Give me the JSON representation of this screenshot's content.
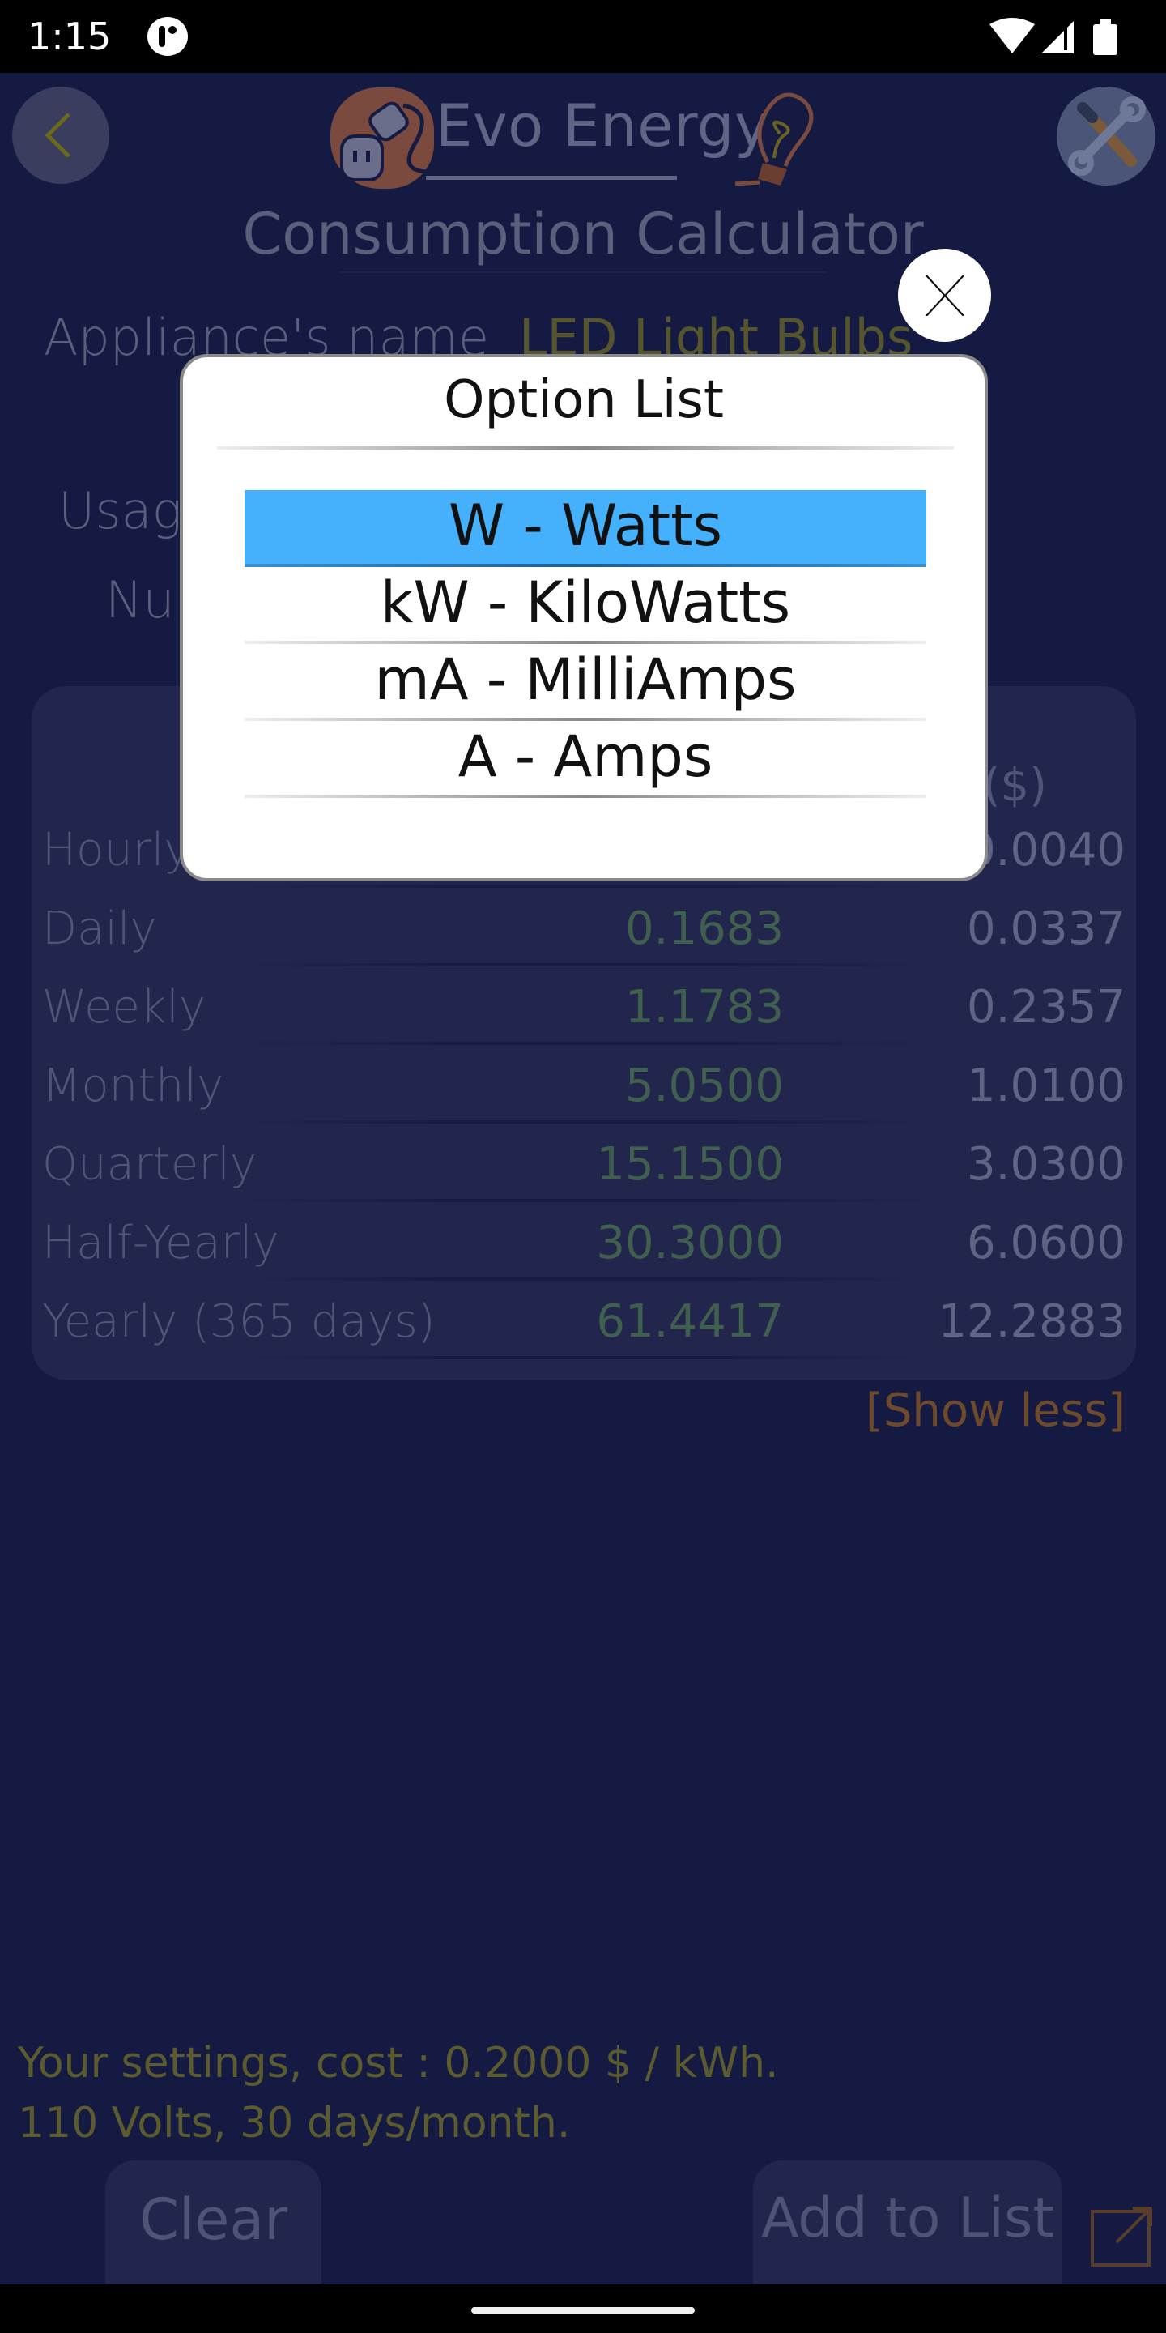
{
  "status_bar": {
    "time": "1:15",
    "icons": [
      "notification-app-icon",
      "wifi-icon",
      "signal-icon",
      "battery-icon"
    ]
  },
  "header": {
    "back_icon": "chevron-left-icon",
    "logo_text": "Evo Energy",
    "settings_icon": "tools-icon"
  },
  "page": {
    "title": "Consumption Calculator",
    "appliance_label": "Appliance's name",
    "appliance_value": "LED Light Bulbs",
    "usage_label": "Usag",
    "number_label": "Nu"
  },
  "results": {
    "cost_header": "($)",
    "rows": [
      {
        "name": "Hourly",
        "kwh": "",
        "cost": "0.0040"
      },
      {
        "name": "Daily",
        "kwh": "0.1683",
        "cost": "0.0337"
      },
      {
        "name": "Weekly",
        "kwh": "1.1783",
        "cost": "0.2357"
      },
      {
        "name": "Monthly",
        "kwh": "5.0500",
        "cost": "1.0100"
      },
      {
        "name": "Quarterly",
        "kwh": "15.1500",
        "cost": "3.0300"
      },
      {
        "name": "Half-Yearly",
        "kwh": "30.3000",
        "cost": "6.0600"
      },
      {
        "name": "Yearly (365 days)",
        "kwh": "61.4417",
        "cost": "12.2883"
      }
    ],
    "show_less": "[Show less]"
  },
  "footer": {
    "settings_line1": "Your settings, cost : 0.2000 $ / kWh.",
    "settings_line2": "110 Volts, 30 days/month.",
    "clear_label": "Clear",
    "add_label": "Add to List",
    "share_icon": "external-link-icon"
  },
  "dialog": {
    "title": "Option List",
    "close_icon": "close-icon",
    "selected_index": 0,
    "options": [
      "W - Watts",
      "kW - KiloWatts",
      "mA - MilliAmps",
      "A - Amps"
    ]
  },
  "colors": {
    "background": "#141a42",
    "panel": "#22264d",
    "selected_option": "#45b0fb",
    "accent_olive": "#5c5a2f",
    "accent_orange": "#6e4a2c"
  }
}
